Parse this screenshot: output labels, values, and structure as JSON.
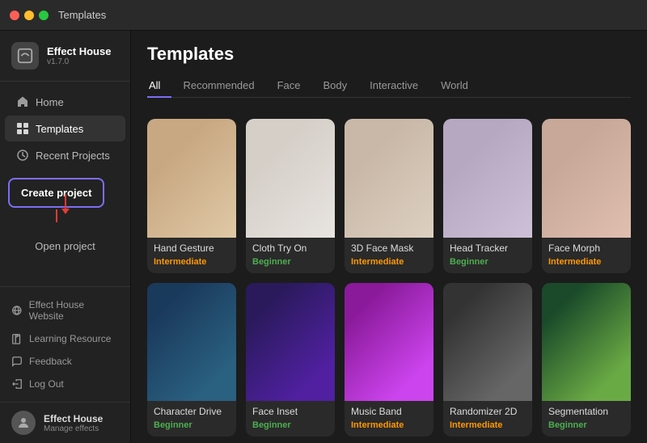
{
  "window": {
    "title": "Templates"
  },
  "titlebar": {
    "title": "Templates"
  },
  "sidebar": {
    "logo_name": "Effect House",
    "logo_version": "v1.7.0",
    "nav_items": [
      {
        "label": "Home",
        "icon": "home-icon",
        "active": false
      },
      {
        "label": "Templates",
        "icon": "templates-icon",
        "active": true
      },
      {
        "label": "Recent Projects",
        "icon": "recent-icon",
        "active": false
      }
    ],
    "create_project_label": "Create project",
    "open_project_label": "Open project",
    "bottom_items": [
      {
        "label": "Effect House Website",
        "icon": "globe-icon"
      },
      {
        "label": "Learning Resource",
        "icon": "book-icon"
      },
      {
        "label": "Feedback",
        "icon": "feedback-icon"
      },
      {
        "label": "Log Out",
        "icon": "logout-icon"
      }
    ],
    "user_name": "Effect House",
    "user_sub": "Manage effects"
  },
  "main": {
    "page_title": "Templates",
    "filter_tabs": [
      {
        "label": "All",
        "active": true
      },
      {
        "label": "Recommended",
        "active": false
      },
      {
        "label": "Face",
        "active": false
      },
      {
        "label": "Body",
        "active": false
      },
      {
        "label": "Interactive",
        "active": false
      },
      {
        "label": "World",
        "active": false
      }
    ],
    "templates": [
      {
        "name": "Hand Gesture",
        "level": "Intermediate",
        "level_class": "level-intermediate",
        "thumb_class": "thumb-hand"
      },
      {
        "name": "Cloth Try On",
        "level": "Beginner",
        "level_class": "level-beginner",
        "thumb_class": "thumb-cloth"
      },
      {
        "name": "3D Face Mask",
        "level": "Intermediate",
        "level_class": "level-intermediate",
        "thumb_class": "thumb-face-mask"
      },
      {
        "name": "Head Tracker",
        "level": "Beginner",
        "level_class": "level-beginner",
        "thumb_class": "thumb-head"
      },
      {
        "name": "Face Morph",
        "level": "Intermediate",
        "level_class": "level-intermediate",
        "thumb_class": "thumb-face-morph"
      },
      {
        "name": "Character Drive",
        "level": "Beginner",
        "level_class": "level-beginner",
        "thumb_class": "thumb-char"
      },
      {
        "name": "Face Inset",
        "level": "Beginner",
        "level_class": "level-beginner",
        "thumb_class": "thumb-inset"
      },
      {
        "name": "Music Band",
        "level": "Intermediate",
        "level_class": "level-intermediate",
        "thumb_class": "thumb-music"
      },
      {
        "name": "Randomizer 2D",
        "level": "Intermediate",
        "level_class": "level-intermediate",
        "thumb_class": "thumb-rand"
      },
      {
        "name": "Segmentation",
        "level": "Beginner",
        "level_class": "level-beginner",
        "thumb_class": "thumb-seg"
      }
    ]
  }
}
